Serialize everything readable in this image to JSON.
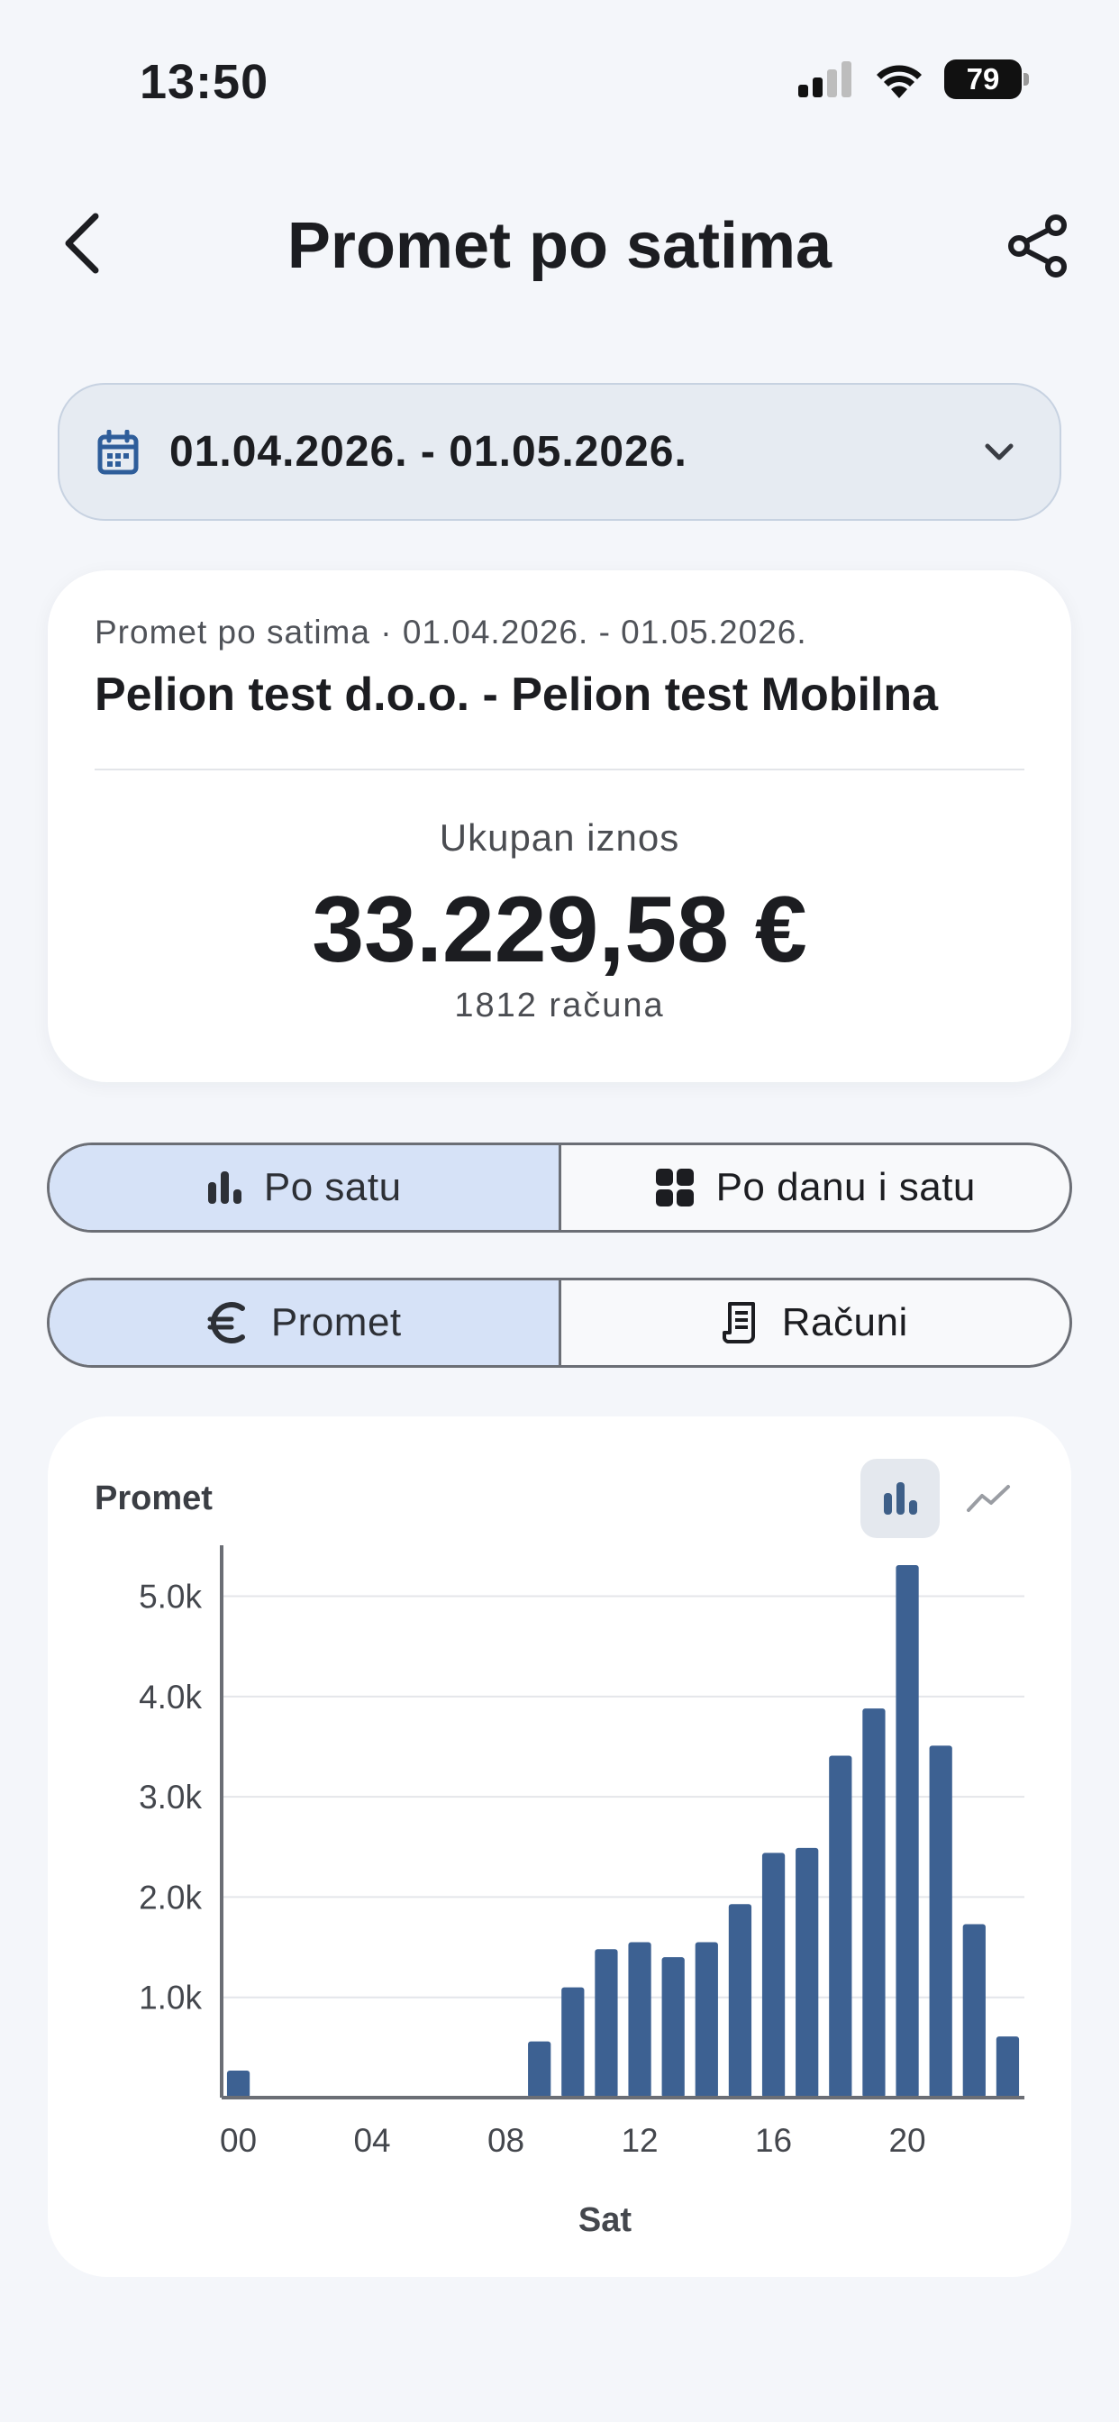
{
  "status_bar": {
    "time": "13:50",
    "battery": "79"
  },
  "header": {
    "title": "Promet po satima"
  },
  "date_range": {
    "value": "01.04.2026. - 01.05.2026."
  },
  "summary": {
    "subtitle": "Promet po satima · 01.04.2026. - 01.05.2026.",
    "company": "Pelion  test d.o.o. - Pelion test Mobilna",
    "total_label": "Ukupan iznos",
    "total_amount": "33.229,58 €",
    "receipt_count": "1812 računa"
  },
  "view_toggle": {
    "options": [
      {
        "label": "Po satu",
        "icon": "bar-chart-icon",
        "active": true
      },
      {
        "label": "Po danu i satu",
        "icon": "grid-icon",
        "active": false
      }
    ]
  },
  "metric_toggle": {
    "options": [
      {
        "label": "Promet",
        "icon": "euro-icon",
        "active": true
      },
      {
        "label": "Računi",
        "icon": "receipt-icon",
        "active": false
      }
    ]
  },
  "chart_card": {
    "title": "Promet",
    "chart_type_options": [
      "bar-chart-icon",
      "line-chart-icon"
    ],
    "selected_chart_type": "bar"
  },
  "chart_data": {
    "type": "bar",
    "x": [
      0,
      1,
      2,
      3,
      4,
      5,
      6,
      7,
      8,
      9,
      10,
      11,
      12,
      13,
      14,
      15,
      16,
      17,
      18,
      19,
      20,
      21,
      22,
      23
    ],
    "values": [
      270,
      0,
      0,
      0,
      0,
      0,
      0,
      0,
      0,
      560,
      1100,
      1480,
      1550,
      1400,
      1550,
      1930,
      2440,
      2490,
      3410,
      3880,
      5310,
      3510,
      1730,
      610
    ],
    "x_tick_labels": [
      "00",
      "04",
      "08",
      "12",
      "16",
      "20"
    ],
    "x_tick_positions": [
      0,
      4,
      8,
      12,
      16,
      20
    ],
    "y_tick_labels": [
      "1.0k",
      "2.0k",
      "3.0k",
      "4.0k",
      "5.0k"
    ],
    "y_ticks": [
      1000,
      2000,
      3000,
      4000,
      5000
    ],
    "ylim": [
      0,
      5400
    ],
    "xlabel": "Sat",
    "ylabel": "",
    "grid": true,
    "bar_color": "#3d6192"
  },
  "colors": {
    "accent_bg": "#d6e2f7",
    "date_bg": "#e6ebf2",
    "bar": "#3d6192"
  }
}
